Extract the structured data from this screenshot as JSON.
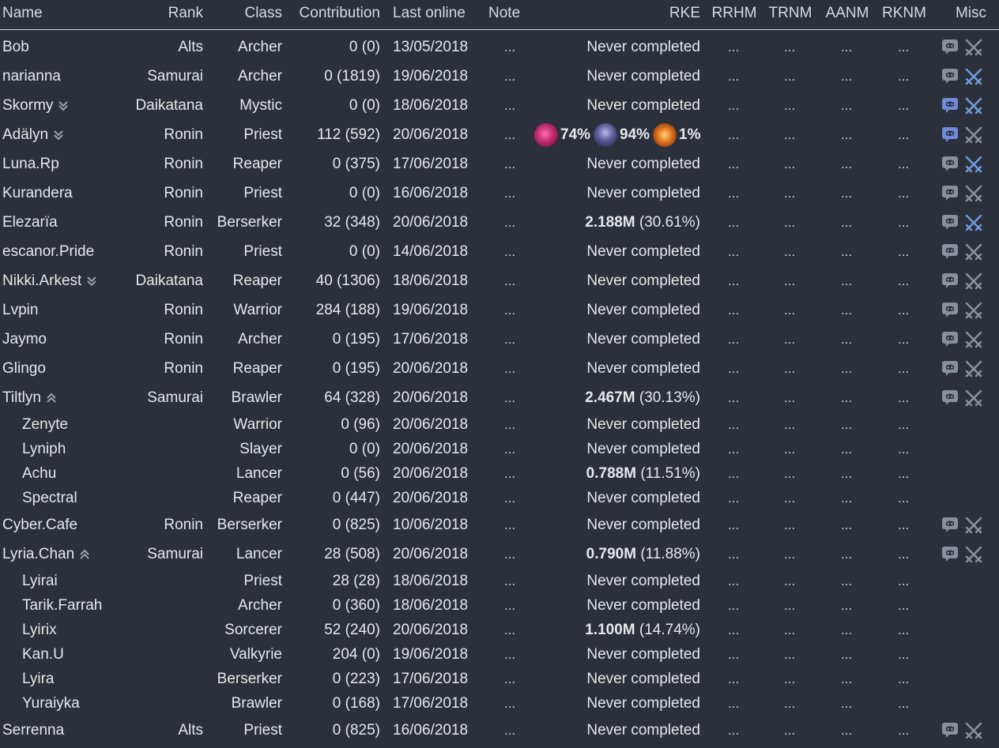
{
  "columns": {
    "name": "Name",
    "rank": "Rank",
    "class": "Class",
    "contribution": "Contribution",
    "last_online": "Last online",
    "note": "Note",
    "rke": "RKE",
    "rrhm": "RRHM",
    "trnm": "TRNM",
    "aanm": "AANM",
    "rknm": "RKNM",
    "misc": "Misc"
  },
  "placeholder": "...",
  "colors": {
    "background": "#2b303b",
    "text": "#e6e8ec",
    "discord_active": "#7289da",
    "discord_inactive": "#8a909b",
    "swords_active": "#6f9bd8",
    "swords_inactive": "#8a909b"
  },
  "rows": [
    {
      "name": "Bob",
      "rank": "Alts",
      "class": "Archer",
      "contribution": "0 (0)",
      "last_online": "13/05/2018",
      "rke": "Never completed",
      "discord": "inactive",
      "swords": "inactive"
    },
    {
      "name": "narianna",
      "rank": "Samurai",
      "class": "Archer",
      "contribution": "0 (1819)",
      "last_online": "19/06/2018",
      "rke": "Never completed",
      "discord": "inactive",
      "swords": "active"
    },
    {
      "name": "Skormy",
      "rank": "Daikatana",
      "class": "Mystic",
      "contribution": "0 (0)",
      "last_online": "18/06/2018",
      "rke": "Never completed",
      "toggle": "expand",
      "discord": "active",
      "swords": "active"
    },
    {
      "name": "Adälyn",
      "rank": "Ronin",
      "class": "Priest",
      "contribution": "112 (592)",
      "last_online": "20/06/2018",
      "rke_clear": {
        "pct1": "74%",
        "pct2": "94%",
        "pct3": "1%"
      },
      "toggle": "expand",
      "discord": "active",
      "swords": "inactive"
    },
    {
      "name": "Luna.Rp",
      "rank": "Ronin",
      "class": "Reaper",
      "contribution": "0 (375)",
      "last_online": "17/06/2018",
      "rke": "Never completed",
      "discord": "inactive",
      "swords": "active"
    },
    {
      "name": "Kurandera",
      "rank": "Ronin",
      "class": "Priest",
      "contribution": "0 (0)",
      "last_online": "16/06/2018",
      "rke": "Never completed",
      "discord": "inactive",
      "swords": "inactive"
    },
    {
      "name": "Elezarïa",
      "rank": "Ronin",
      "class": "Berserker",
      "contribution": "32 (348)",
      "last_online": "20/06/2018",
      "rke_dps": "2.188M",
      "rke_pct": "(30.61%)",
      "discord": "inactive",
      "swords": "active"
    },
    {
      "name": "escanor.Pride",
      "rank": "Ronin",
      "class": "Priest",
      "contribution": "0 (0)",
      "last_online": "14/06/2018",
      "rke": "Never completed",
      "discord": "inactive",
      "swords": "inactive"
    },
    {
      "name": "Nikki.Arkest",
      "rank": "Daikatana",
      "class": "Reaper",
      "contribution": "40 (1306)",
      "last_online": "18/06/2018",
      "rke": "Never completed",
      "toggle": "expand",
      "discord": "inactive",
      "swords": "inactive"
    },
    {
      "name": "Lvpin",
      "rank": "Ronin",
      "class": "Warrior",
      "contribution": "284 (188)",
      "last_online": "19/06/2018",
      "rke": "Never completed",
      "discord": "inactive",
      "swords": "inactive"
    },
    {
      "name": "Jaymo",
      "rank": "Ronin",
      "class": "Archer",
      "contribution": "0 (195)",
      "last_online": "17/06/2018",
      "rke": "Never completed",
      "discord": "inactive",
      "swords": "inactive"
    },
    {
      "name": "Glingo",
      "rank": "Ronin",
      "class": "Reaper",
      "contribution": "0 (195)",
      "last_online": "20/06/2018",
      "rke": "Never completed",
      "discord": "inactive",
      "swords": "inactive"
    },
    {
      "name": "Tiltlyn",
      "rank": "Samurai",
      "class": "Brawler",
      "contribution": "64 (328)",
      "last_online": "20/06/2018",
      "rke_dps": "2.467M",
      "rke_pct": "(30.13%)",
      "toggle": "collapse",
      "discord": "inactive",
      "swords": "inactive"
    },
    {
      "name": "Zenyte",
      "sub": true,
      "rank": "",
      "class": "Warrior",
      "contribution": "0 (96)",
      "last_online": "20/06/2018",
      "rke": "Never completed"
    },
    {
      "name": "Lyniph",
      "sub": true,
      "rank": "",
      "class": "Slayer",
      "contribution": "0 (0)",
      "last_online": "20/06/2018",
      "rke": "Never completed"
    },
    {
      "name": "Achu",
      "sub": true,
      "rank": "",
      "class": "Lancer",
      "contribution": "0 (56)",
      "last_online": "20/06/2018",
      "rke_dps": "0.788M",
      "rke_pct": "(11.51%)"
    },
    {
      "name": "Spectral",
      "sub": true,
      "rank": "",
      "class": "Reaper",
      "contribution": "0 (447)",
      "last_online": "20/06/2018",
      "rke": "Never completed"
    },
    {
      "name": "Cyber.Cafe",
      "rank": "Ronin",
      "class": "Berserker",
      "contribution": "0 (825)",
      "last_online": "10/06/2018",
      "rke": "Never completed",
      "discord": "inactive",
      "swords": "inactive"
    },
    {
      "name": "Lyria.Chan",
      "rank": "Samurai",
      "class": "Lancer",
      "contribution": "28 (508)",
      "last_online": "20/06/2018",
      "rke_dps": "0.790M",
      "rke_pct": "(11.88%)",
      "toggle": "collapse",
      "discord": "inactive",
      "swords": "inactive"
    },
    {
      "name": "Lyirai",
      "sub": true,
      "rank": "",
      "class": "Priest",
      "contribution": "28 (28)",
      "last_online": "18/06/2018",
      "rke": "Never completed"
    },
    {
      "name": "Tarik.Farrah",
      "sub": true,
      "rank": "",
      "class": "Archer",
      "contribution": "0 (360)",
      "last_online": "18/06/2018",
      "rke": "Never completed"
    },
    {
      "name": "Lyirix",
      "sub": true,
      "rank": "",
      "class": "Sorcerer",
      "contribution": "52 (240)",
      "last_online": "20/06/2018",
      "rke_dps": "1.100M",
      "rke_pct": "(14.74%)"
    },
    {
      "name": "Kan.U",
      "sub": true,
      "rank": "",
      "class": "Valkyrie",
      "contribution": "204 (0)",
      "last_online": "19/06/2018",
      "rke": "Never completed"
    },
    {
      "name": "Lyira",
      "sub": true,
      "rank": "",
      "class": "Berserker",
      "contribution": "0 (223)",
      "last_online": "17/06/2018",
      "rke": "Never completed"
    },
    {
      "name": "Yuraiyka",
      "sub": true,
      "rank": "",
      "class": "Brawler",
      "contribution": "0 (168)",
      "last_online": "17/06/2018",
      "rke": "Never completed"
    },
    {
      "name": "Serrenna",
      "rank": "Alts",
      "class": "Priest",
      "contribution": "0 (825)",
      "last_online": "16/06/2018",
      "rke": "Never completed",
      "discord": "inactive",
      "swords": "inactive"
    }
  ]
}
